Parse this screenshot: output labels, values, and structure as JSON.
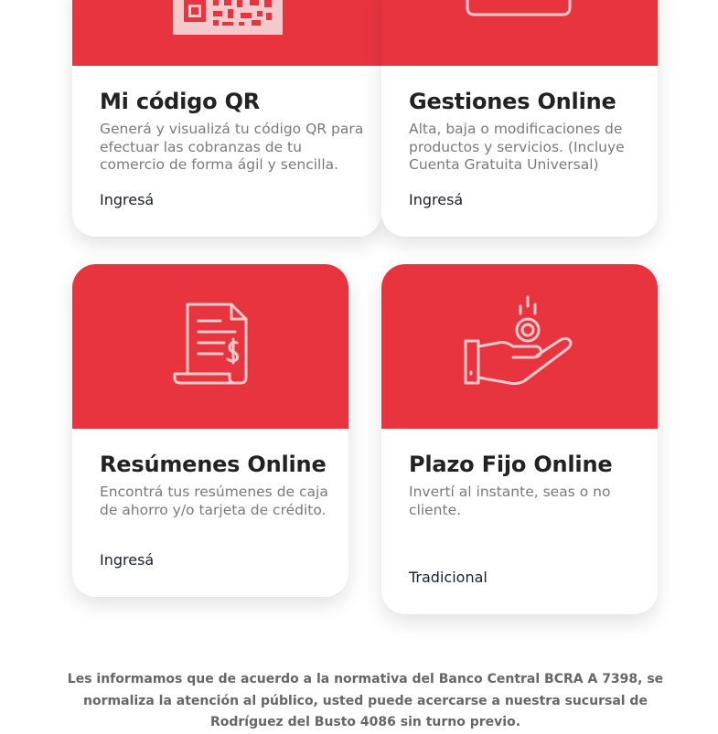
{
  "cards": [
    {
      "icon": "qr-code-icon",
      "title": "Mi código QR",
      "description": "Generá y visualizá tu código QR para efectuar las cobranzas de tu comercio de forma ágil y sencilla.",
      "link": "Ingresá"
    },
    {
      "icon": "laptop-icon",
      "title": "Gestiones Online",
      "description": "Alta, baja o modificaciones de productos y servicios. (Incluye Cuenta Gratuita Universal)",
      "link": "Ingresá"
    },
    {
      "icon": "receipt-dollar-icon",
      "title": "Resúmenes Online",
      "description": "Encontrá tus resúmenes de caja de ahorro y/o tarjeta de crédito.",
      "link": "Ingresá"
    },
    {
      "icon": "hand-coin-icon",
      "title": "Plazo Fijo Online",
      "description": "Invertí al instante, seas o no cliente.",
      "link": "Tradicional"
    }
  ],
  "notice": "Les informamos que de acuerdo a la normativa del Banco Central BCRA A 7398, se normaliza la atención al público, usted puede acercarse a nuestra sucursal de Rodríguez del Busto 4086 sin turno previo.",
  "colors": {
    "accent": "#e8343f",
    "title": "#222222",
    "text": "#7a7a7a",
    "link": "#1a1f2e"
  }
}
